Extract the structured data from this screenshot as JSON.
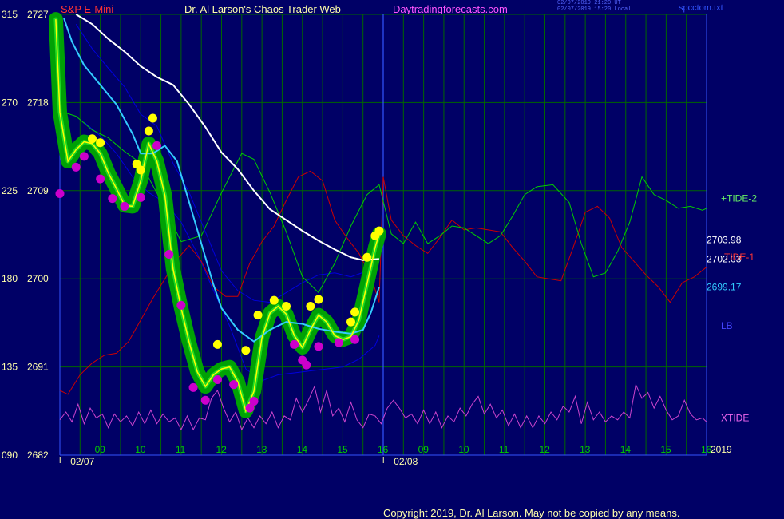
{
  "header": {
    "symbol": "S&P E-Mini",
    "title": "Dr. Al Larson's Chaos Trader Web",
    "site": "Daytradingforecasts.com",
    "stamp_utc": "02/07/2019 21:20 UT",
    "stamp_local": "02/07/2019 15:20 Local",
    "file": "spcctom.txt"
  },
  "footer": {
    "copyright": "Copyright 2019, Dr. Al Larson. May not be copied by any means."
  },
  "colors": {
    "background": "#000066",
    "grid": "#006600",
    "axis": "#3355ff",
    "price": "#ffff00",
    "glow": "#00aa00",
    "dot_high": "#ffff00",
    "dot_low": "#cc00cc",
    "tide2": "#00cc00",
    "tide1": "#cc0000",
    "xtide": "#cc44cc",
    "white_ma": "#ffffff",
    "cyan_ma": "#33ccff",
    "band": "#0000dd"
  },
  "chart_data": {
    "type": "line",
    "ylim": [
      2682,
      2727
    ],
    "y_left_ticks": [
      "315",
      "270",
      "225",
      "180",
      "135",
      "090"
    ],
    "y_right_ticks": [
      "2727",
      "2718",
      "2709",
      "2700",
      "2691",
      "2682"
    ],
    "y_ticks_values": [
      2727,
      2718,
      2709,
      2700,
      2691,
      2682
    ],
    "xlim": [
      8,
      16
    ],
    "x_hour_labels": [
      {
        "x": 9,
        "label": "09"
      },
      {
        "x": 10,
        "label": "10"
      },
      {
        "x": 11,
        "label": "11"
      },
      {
        "x": 12,
        "label": "12"
      },
      {
        "x": 13,
        "label": "13"
      },
      {
        "x": 14,
        "label": "14"
      },
      {
        "x": 15,
        "label": "15"
      },
      {
        "x": 16,
        "label": "16"
      },
      {
        "x": 17,
        "label": "09"
      },
      {
        "x": 18,
        "label": "10"
      },
      {
        "x": 19,
        "label": "11"
      },
      {
        "x": 20,
        "label": "12"
      },
      {
        "x": 21,
        "label": "13"
      },
      {
        "x": 22,
        "label": "14"
      },
      {
        "x": 23,
        "label": "15"
      },
      {
        "x": 24,
        "label": "16"
      }
    ],
    "x_date_labels": [
      {
        "x": 8.4,
        "label": "02/07"
      },
      {
        "x": 16.4,
        "label": "02/08"
      }
    ],
    "year_label": "2019",
    "right_labels": [
      {
        "text": "+TIDE-2",
        "y": 2708.2,
        "color": "#66ee66"
      },
      {
        "text": "2703.98",
        "y": 2703.98,
        "color": "#ffffff"
      },
      {
        "text": "2702.03",
        "y": 2702.03,
        "color": "#ffffff"
      },
      {
        "text": "TIDE-1",
        "y": 2702.2,
        "color": "#ff3333"
      },
      {
        "text": "2699.17",
        "y": 2699.17,
        "color": "#33ccff"
      },
      {
        "text": "LB",
        "y": 2695.2,
        "color": "#4444ff"
      },
      {
        "text": "XTIDE",
        "y": 2685.8,
        "color": "#ee66ee"
      }
    ],
    "series": [
      {
        "key": "price",
        "x": [
          7.9,
          8.0,
          8.2,
          8.4,
          8.6,
          8.8,
          9.0,
          9.2,
          9.4,
          9.6,
          9.8,
          10.0,
          10.1,
          10.2,
          10.4,
          10.6,
          10.8,
          11.0,
          11.2,
          11.4,
          11.6,
          11.8,
          12.0,
          12.2,
          12.4,
          12.6,
          12.8,
          13.0,
          13.2,
          13.4,
          13.6,
          13.8,
          14.0,
          14.2,
          14.4,
          14.6,
          14.8,
          15.0,
          15.2,
          15.4,
          15.6,
          15.8,
          15.9
        ],
        "y": [
          2726.5,
          2717,
          2712,
          2713.2,
          2714,
          2713.8,
          2712.8,
          2710.8,
          2709.2,
          2707.5,
          2707.4,
          2710,
          2712,
          2713.8,
          2712,
          2708.5,
          2701,
          2697,
          2693.5,
          2690.5,
          2689,
          2690.2,
          2690.8,
          2691,
          2689.5,
          2686.5,
          2688.5,
          2694,
          2696.5,
          2697.2,
          2696.4,
          2694.2,
          2693,
          2694.8,
          2696.3,
          2695.6,
          2694.2,
          2693.8,
          2694.1,
          2695.8,
          2699.5,
          2703.2,
          2704.6
        ]
      },
      {
        "key": "white",
        "x": [
          8.4,
          8.8,
          9.2,
          9.6,
          10.0,
          10.4,
          10.8,
          11.2,
          11.6,
          12.0,
          12.4,
          12.8,
          13.2,
          13.6,
          14.0,
          14.4,
          14.8,
          15.2,
          15.5,
          15.9
        ],
        "y": [
          2727,
          2726,
          2724.5,
          2723.2,
          2721.7,
          2720.6,
          2719.8,
          2717.8,
          2715.5,
          2712.9,
          2711.2,
          2709,
          2707.1,
          2706,
          2704.9,
          2703.9,
          2703,
          2702.2,
          2701.9,
          2702.03
        ]
      },
      {
        "key": "cyan",
        "x": [
          8.1,
          8.3,
          8.6,
          9.0,
          9.4,
          9.8,
          10.0,
          10.3,
          10.6,
          10.9,
          11.2,
          11.5,
          11.8,
          12.0,
          12.4,
          12.8,
          13.2,
          13.6,
          14.0,
          14.4,
          14.8,
          15.2,
          15.5,
          15.7,
          15.9
        ],
        "y": [
          2726.6,
          2724.2,
          2721.8,
          2719.8,
          2717.8,
          2714.8,
          2712.8,
          2712.8,
          2713.6,
          2712,
          2707.8,
          2703.6,
          2699.4,
          2697,
          2694.8,
          2693.6,
          2694.8,
          2695.6,
          2695.4,
          2694.9,
          2694.6,
          2694.4,
          2694.8,
          2696.6,
          2699.17
        ]
      },
      {
        "key": "band_top",
        "x": [
          8.4,
          8.8,
          9.2,
          9.6,
          10.0,
          10.4,
          10.8,
          11.2,
          11.6,
          12.0,
          12.4,
          12.8,
          13.2,
          13.6,
          14.0,
          14.4,
          14.8,
          15.2,
          15.6,
          15.9
        ],
        "y": [
          2726,
          2723.5,
          2721.5,
          2719.6,
          2716.8,
          2715.6,
          2711.8,
          2708.8,
          2704.8,
          2700.8,
          2698.8,
          2697.8,
          2697.6,
          2698.6,
          2699.6,
          2700.4,
          2700.6,
          2700.2,
          2700.8,
          2702.2
        ]
      },
      {
        "key": "band_bot",
        "x": [
          8.6,
          9.0,
          9.4,
          9.8,
          10.2,
          10.6,
          11.0,
          11.4,
          11.8,
          12.2,
          12.6,
          13.0,
          13.4,
          13.8,
          14.2,
          14.6,
          15.0,
          15.4,
          15.8,
          15.9
        ],
        "y": [
          2716,
          2714.6,
          2712.8,
          2710.4,
          2708.8,
          2707.8,
          2705.8,
          2702.6,
          2698.8,
          2695.2,
          2690.8,
          2689.6,
          2690.2,
          2690.4,
          2690.6,
          2690.8,
          2691,
          2691.8,
          2693.2,
          2694.2
        ]
      },
      {
        "key": "tide2",
        "x": [
          8.0,
          8.1,
          8.4,
          8.8,
          9.2,
          9.6,
          10.0,
          10.5,
          11.0,
          11.5,
          12.0,
          12.5,
          12.8,
          13.2,
          13.6,
          14.0,
          14.4,
          14.8,
          15.2,
          15.6,
          15.9,
          16.2,
          16.5,
          16.8,
          17.1,
          17.4,
          17.7,
          18.0,
          18.3,
          18.6,
          18.9,
          19.2,
          19.5,
          19.8,
          20.2,
          20.6,
          20.9,
          21.2,
          21.5,
          21.8,
          22.1,
          22.4,
          22.7,
          23.0,
          23.3,
          23.6,
          23.9,
          24.0
        ],
        "y": [
          2713.1,
          2717,
          2716.6,
          2715.2,
          2714.4,
          2713,
          2711.8,
          2708,
          2703.8,
          2704.4,
          2708.8,
          2712.8,
          2712.2,
          2708.8,
          2704.8,
          2700.2,
          2698.6,
          2701.6,
          2705.4,
          2708.6,
          2709.6,
          2704.6,
          2703.6,
          2705.8,
          2703.6,
          2704.4,
          2705.4,
          2705.2,
          2704.4,
          2703.6,
          2704.4,
          2706.4,
          2708.6,
          2709.4,
          2709.6,
          2707.8,
          2703.6,
          2700.2,
          2700.6,
          2702.8,
          2705.8,
          2710.4,
          2708.6,
          2708,
          2707.2,
          2707.4,
          2707,
          2707.2
        ]
      },
      {
        "key": "tide1",
        "x": [
          8.0,
          8.2,
          8.5,
          8.8,
          9.1,
          9.4,
          9.7,
          10.0,
          10.3,
          10.6,
          10.9,
          11.2,
          11.5,
          11.8,
          12.1,
          12.4,
          12.7,
          13.0,
          13.3,
          13.6,
          13.9,
          14.2,
          14.5,
          14.8,
          15.1,
          15.4,
          15.7,
          15.9,
          16.0,
          16.2,
          16.5,
          16.8,
          17.1,
          17.4,
          17.7,
          18.0,
          18.3,
          18.6,
          18.9,
          19.2,
          19.5,
          19.8,
          20.1,
          20.4,
          20.7,
          21.0,
          21.3,
          21.6,
          21.9,
          22.2,
          22.5,
          22.8,
          23.1,
          23.4,
          23.7,
          24.0
        ],
        "y": [
          2688.6,
          2688.2,
          2690.2,
          2691.4,
          2692.2,
          2692.4,
          2693.6,
          2695.8,
          2698,
          2700,
          2702,
          2703.4,
          2701.8,
          2699.2,
          2698.2,
          2698.2,
          2701.6,
          2703.8,
          2705.4,
          2708,
          2710.4,
          2711,
          2710,
          2706,
          2704.2,
          2702.6,
          2700.2,
          2697.6,
          2710.4,
          2706,
          2704.4,
          2703.4,
          2702.6,
          2704.2,
          2706,
          2705,
          2705.2,
          2705,
          2704.8,
          2703.2,
          2701.8,
          2700.2,
          2700,
          2699.8,
          2703.2,
          2706.8,
          2707.4,
          2706.2,
          2703.2,
          2701.8,
          2700.4,
          2699.2,
          2697.6,
          2699.6,
          2700.2,
          2701.2
        ]
      },
      {
        "key": "xtide",
        "x": [
          8.0,
          8.15,
          8.3,
          8.45,
          8.6,
          8.75,
          8.9,
          9.05,
          9.2,
          9.35,
          9.5,
          9.65,
          9.8,
          9.95,
          10.1,
          10.25,
          10.4,
          10.55,
          10.7,
          10.85,
          11.0,
          11.15,
          11.3,
          11.45,
          11.6,
          11.75,
          11.9,
          12.05,
          12.2,
          12.35,
          12.5,
          12.65,
          12.8,
          12.95,
          13.1,
          13.25,
          13.4,
          13.55,
          13.7,
          13.85,
          14.0,
          14.15,
          14.3,
          14.45,
          14.6,
          14.75,
          14.9,
          15.05,
          15.2,
          15.35,
          15.5,
          15.65,
          15.8,
          15.95,
          16.1,
          16.25,
          16.4,
          16.55,
          16.7,
          16.85,
          17.0,
          17.15,
          17.3,
          17.45,
          17.6,
          17.75,
          17.9,
          18.05,
          18.2,
          18.35,
          18.5,
          18.65,
          18.8,
          18.95,
          19.1,
          19.25,
          19.4,
          19.55,
          19.7,
          19.85,
          20.0,
          20.15,
          20.3,
          20.45,
          20.6,
          20.75,
          20.9,
          21.05,
          21.2,
          21.35,
          21.5,
          21.65,
          21.8,
          21.95,
          22.1,
          22.25,
          22.4,
          22.55,
          22.7,
          22.85,
          23.0,
          23.15,
          23.3,
          23.45,
          23.6,
          23.75,
          23.9,
          24.0
        ],
        "y": [
          2685.6,
          2686.4,
          2685.4,
          2687.2,
          2685.2,
          2686.8,
          2685.8,
          2686.2,
          2684.8,
          2686.2,
          2685.4,
          2686,
          2685,
          2686.4,
          2685.2,
          2686.6,
          2685.2,
          2686.2,
          2685.4,
          2685.8,
          2684.6,
          2686,
          2684.6,
          2685.8,
          2685.6,
          2687.8,
          2688.6,
          2686.8,
          2685.4,
          2686.4,
          2684.6,
          2685.8,
          2684.8,
          2686,
          2685.2,
          2686.4,
          2684.8,
          2686,
          2685.6,
          2687.8,
          2686.4,
          2687.6,
          2689,
          2686.4,
          2688.6,
          2686,
          2686.8,
          2685.4,
          2687.4,
          2685.6,
          2684.8,
          2686.2,
          2686,
          2685.2,
          2686.8,
          2687.6,
          2686.8,
          2685.8,
          2686.2,
          2685.2,
          2686.6,
          2685.2,
          2686.4,
          2684.8,
          2686,
          2685.4,
          2686.8,
          2686,
          2687.2,
          2688,
          2686.2,
          2687.2,
          2685.8,
          2686.6,
          2685,
          2686.2,
          2684.8,
          2686,
          2684.8,
          2686,
          2685.2,
          2686.4,
          2685.6,
          2687,
          2686.4,
          2688,
          2685.2,
          2687.4,
          2685.6,
          2686.4,
          2685.4,
          2686,
          2685.6,
          2686.4,
          2685.8,
          2689.2,
          2687.8,
          2688.4,
          2686.8,
          2688,
          2686.6,
          2685.6,
          2686,
          2687.6,
          2686.2,
          2685.6,
          2685.8,
          2685.4
        ]
      }
    ],
    "high_points": [
      [
        8.8,
        2714.3
      ],
      [
        9.0,
        2713.9
      ],
      [
        9.9,
        2711.7
      ],
      [
        10.0,
        2711.1
      ],
      [
        10.2,
        2715.1
      ],
      [
        10.3,
        2716.4
      ],
      [
        11.9,
        2693.3
      ],
      [
        12.6,
        2692.7
      ],
      [
        12.9,
        2696.3
      ],
      [
        13.3,
        2697.8
      ],
      [
        13.6,
        2697.2
      ],
      [
        14.2,
        2697.2
      ],
      [
        14.4,
        2697.9
      ],
      [
        15.2,
        2695.6
      ],
      [
        15.3,
        2696.6
      ],
      [
        15.6,
        2702.2
      ],
      [
        15.8,
        2704.4
      ],
      [
        15.9,
        2704.9
      ]
    ],
    "low_points": [
      [
        8.0,
        2708.7
      ],
      [
        8.4,
        2711.4
      ],
      [
        8.6,
        2712.5
      ],
      [
        9.0,
        2710.2
      ],
      [
        9.3,
        2708.2
      ],
      [
        9.6,
        2707.4
      ],
      [
        10.0,
        2708.3
      ],
      [
        10.4,
        2713.6
      ],
      [
        10.7,
        2702.5
      ],
      [
        11.0,
        2697.3
      ],
      [
        11.3,
        2688.9
      ],
      [
        11.6,
        2687.6
      ],
      [
        11.9,
        2689.7
      ],
      [
        12.3,
        2689.2
      ],
      [
        12.7,
        2686.8
      ],
      [
        12.8,
        2687.5
      ],
      [
        13.8,
        2693.3
      ],
      [
        14.0,
        2691.7
      ],
      [
        14.1,
        2691.2
      ],
      [
        14.4,
        2693.1
      ],
      [
        14.9,
        2693.5
      ],
      [
        15.3,
        2693.8
      ]
    ]
  }
}
